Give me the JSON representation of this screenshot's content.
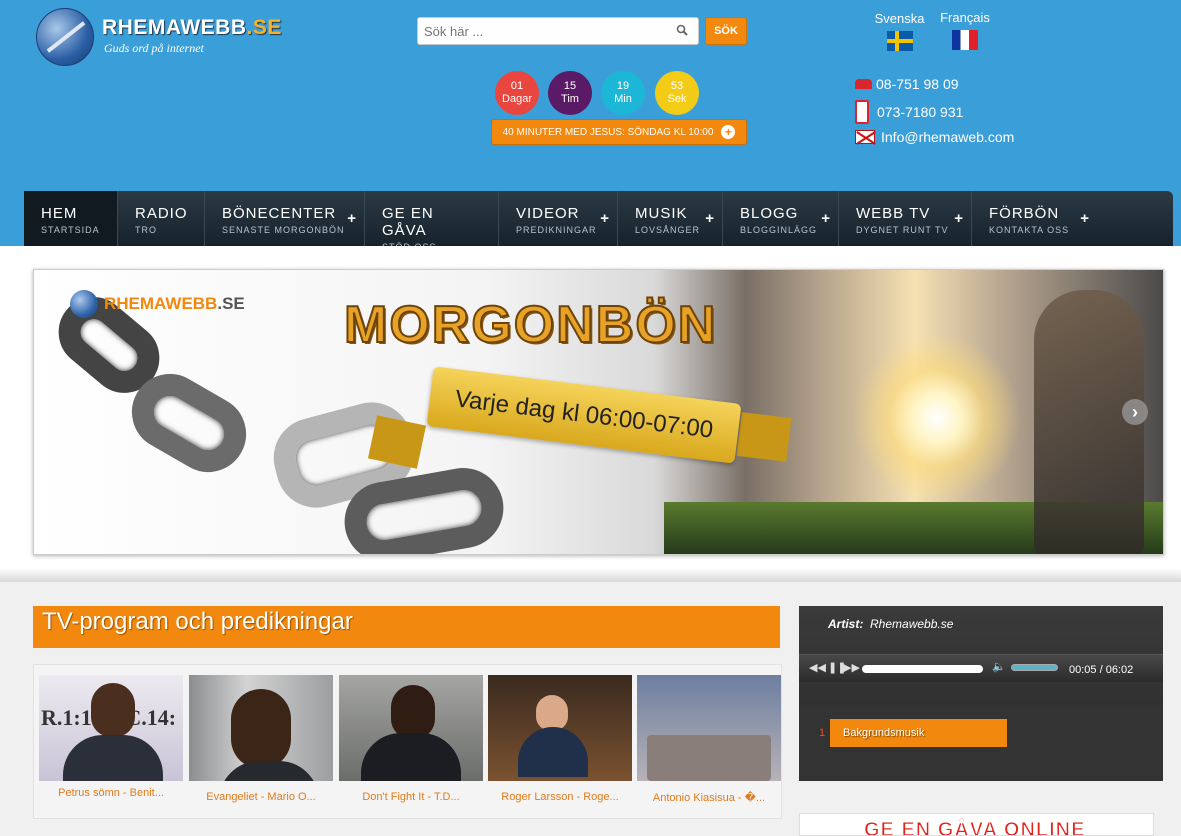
{
  "header": {
    "logo": {
      "brand_main": "RHEMAWEBB",
      "brand_tld": ".SE",
      "tagline": "Guds ord på internet"
    },
    "search": {
      "placeholder": "Sök här ...",
      "button_label": "SÖK"
    },
    "countdown": [
      {
        "value": "01",
        "unit": "Dagar"
      },
      {
        "value": "15",
        "unit": "Tim"
      },
      {
        "value": "19",
        "unit": "Min"
      },
      {
        "value": "53",
        "unit": "Sek"
      }
    ],
    "event_button_label": "40 MINUTER MED JESUS: SÖNDAG KL 10:00",
    "languages": [
      {
        "label": "Svenska"
      },
      {
        "label": "Français"
      }
    ],
    "contact": {
      "phone": "08-751 98 09",
      "mobile": "073-7180 931",
      "email": "Info@rhemaweb.com"
    }
  },
  "nav": [
    {
      "title": "HEM",
      "sub": "STARTSIDA"
    },
    {
      "title": "RADIO",
      "sub": "TRO"
    },
    {
      "title": "BÖNECENTER",
      "sub": "SENASTE MORGONBÖN"
    },
    {
      "title": "GE EN GÅVA",
      "sub": "STÖD OSS"
    },
    {
      "title": "VIDEOR",
      "sub": "PREDIKNINGAR"
    },
    {
      "title": "MUSIK",
      "sub": "LOVSÅNGER"
    },
    {
      "title": "BLOGG",
      "sub": "BLOGGINLÄGG"
    },
    {
      "title": "WEBB TV",
      "sub": "DYGNET RUNT TV"
    },
    {
      "title": "FÖRBÖN",
      "sub": "KONTAKTA OSS"
    }
  ],
  "banner": {
    "logo_main": "RHEMAWEBB",
    "logo_tld": ".SE",
    "title": "MORGONBÖN",
    "ribbon_text": "Varje dag kl 06:00-07:00"
  },
  "tv_section": {
    "heading": "TV-program och predikningar",
    "videos": [
      {
        "caption": "Petrus sömn - Benit..."
      },
      {
        "caption": "Evangeliet - Mario O..."
      },
      {
        "caption": "Don't Fight It - T.D..."
      },
      {
        "caption": "Roger Larsson - Roge..."
      },
      {
        "caption": "Antonio Kiasisua - �..."
      }
    ]
  },
  "player": {
    "artist_label": "Artist:",
    "artist_name": "Rhemawebb.se",
    "time": "00:05 / 06:02",
    "progress": 0.014,
    "playlist": [
      {
        "num": "1",
        "title": "Bakgrundsmusik"
      }
    ]
  },
  "gift_banner_text": "GE EN GÅVA ONLINE",
  "colors": {
    "header_bg": "#3a9fd9",
    "accent": "#f2890e",
    "nav_bg": "#1f2c36"
  }
}
